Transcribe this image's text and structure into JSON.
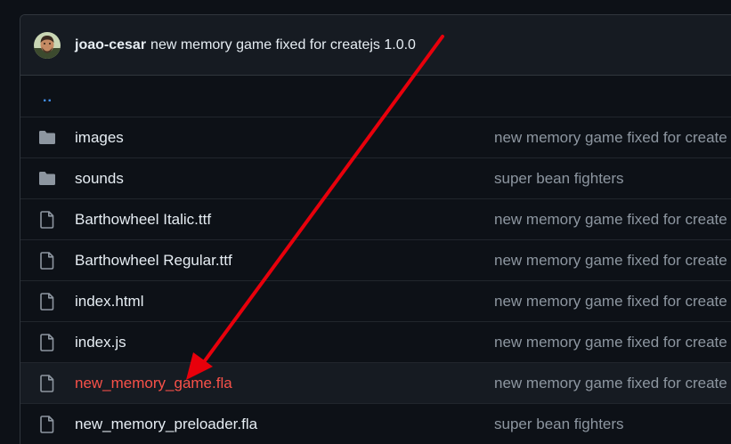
{
  "commit": {
    "author": "joao-cesar",
    "message": "new memory game fixed for createjs 1.0.0"
  },
  "parent_link": "..",
  "files": [
    {
      "name": "images",
      "type": "folder",
      "icon": "folder-icon",
      "message": "new memory game fixed for create"
    },
    {
      "name": "sounds",
      "type": "folder",
      "icon": "folder-icon",
      "message": "super bean fighters"
    },
    {
      "name": "Barthowheel Italic.ttf",
      "type": "file",
      "icon": "file-icon",
      "message": "new memory game fixed for create"
    },
    {
      "name": "Barthowheel Regular.ttf",
      "type": "file",
      "icon": "file-icon",
      "message": "new memory game fixed for create"
    },
    {
      "name": "index.html",
      "type": "file",
      "icon": "file-icon",
      "message": "new memory game fixed for create"
    },
    {
      "name": "index.js",
      "type": "file",
      "icon": "file-icon",
      "message": "new memory game fixed for create"
    },
    {
      "name": "new_memory_game.fla",
      "type": "file",
      "icon": "file-icon",
      "message": "new memory game fixed for create",
      "highlighted": true
    },
    {
      "name": "new_memory_preloader.fla",
      "type": "file",
      "icon": "file-icon",
      "message": "super bean fighters"
    }
  ],
  "colors": {
    "background": "#0d1117",
    "header": "#161b22",
    "border": "#30363d",
    "text": "#e6edf3",
    "muted": "#8d96a0",
    "link": "#4493f8",
    "highlight_text": "#f85149",
    "annotation_arrow": "#e8000b"
  }
}
